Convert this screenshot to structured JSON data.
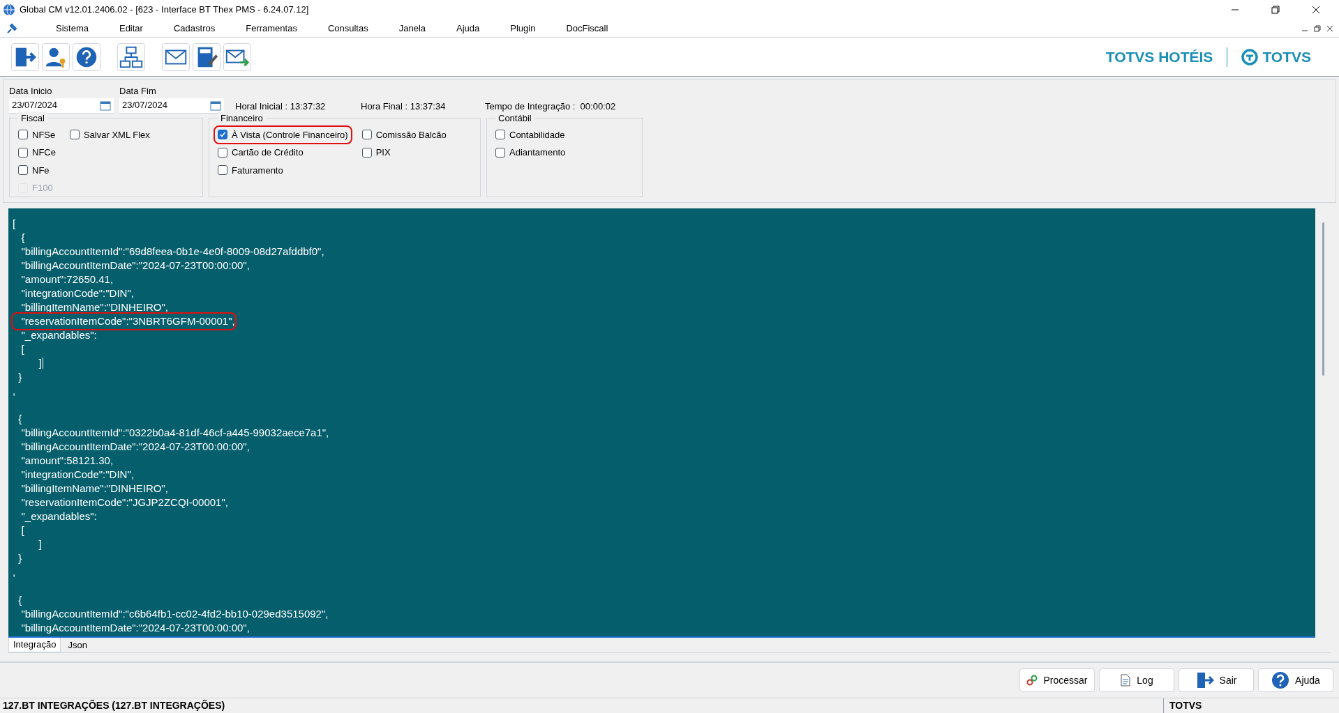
{
  "window": {
    "title": "Global CM v12.01.2406.02 - [623 - Interface BT Thex PMS - 6.24.07.12]"
  },
  "menu": [
    "Sistema",
    "Editar",
    "Cadastros",
    "Ferramentas",
    "Consultas",
    "Janela",
    "Ajuda",
    "Plugin",
    "DocFiscall"
  ],
  "brand": {
    "hotels": "TOTVS HOTÉIS",
    "logo": "TOTVS"
  },
  "dates": [
    {
      "label": "Data Inicio",
      "value": "23/07/2024"
    },
    {
      "label": "Data Fim",
      "value": "23/07/2024"
    }
  ],
  "times": [
    "Horal Inicial : 13:37:32",
    "Hora Final : 13:37:34",
    "Tempo de Integração :  00:00:02"
  ],
  "groups": [
    {
      "title": "Fiscal",
      "columns": [
        [
          {
            "label": "NFSe",
            "checked": false,
            "disabled": false,
            "highlighted": false
          },
          {
            "label": "NFCe",
            "checked": false,
            "disabled": false,
            "highlighted": false
          },
          {
            "label": "NFe",
            "checked": false,
            "disabled": false,
            "highlighted": false
          },
          {
            "label": "F100",
            "checked": false,
            "disabled": true,
            "highlighted": false
          }
        ],
        [
          {
            "label": "Salvar XML Flex",
            "checked": false,
            "disabled": false,
            "highlighted": false
          }
        ]
      ]
    },
    {
      "title": "Financeiro",
      "columns": [
        [
          {
            "label": "À Vista (Controle Financeiro)",
            "checked": true,
            "disabled": false,
            "highlighted": true
          },
          {
            "label": "Cartão de Crédito",
            "checked": false,
            "disabled": false,
            "highlighted": false
          },
          {
            "label": "Faturamento",
            "checked": false,
            "disabled": false,
            "highlighted": false
          }
        ],
        [
          {
            "label": "Comissão Balcão",
            "checked": false,
            "disabled": false,
            "highlighted": false
          },
          {
            "label": "PIX",
            "checked": false,
            "disabled": false,
            "highlighted": false
          }
        ]
      ]
    },
    {
      "title": "Contábil",
      "columns": [
        [
          {
            "label": "Contabilidade",
            "checked": false,
            "disabled": false,
            "highlighted": false
          },
          {
            "label": "Adiantamento",
            "checked": false,
            "disabled": false,
            "highlighted": false
          }
        ]
      ]
    }
  ],
  "json_lines": [
    {
      "kind": "line",
      "text": "[",
      "highlighted": false,
      "cursor": false
    },
    {
      "kind": "line",
      "text": "   {",
      "highlighted": false,
      "cursor": false
    },
    {
      "kind": "line",
      "text": "   \"billingAccountItemId\":\"69d8feea-0b1e-4e0f-8009-08d27afddbf0\",",
      "highlighted": false,
      "cursor": false
    },
    {
      "kind": "line",
      "text": "   \"billingAccountItemDate\":\"2024-07-23T00:00:00\",",
      "highlighted": false,
      "cursor": false
    },
    {
      "kind": "line",
      "text": "   \"amount\":72650.41,",
      "highlighted": false,
      "cursor": false
    },
    {
      "kind": "line",
      "text": "   \"integrationCode\":\"DIN\",",
      "highlighted": false,
      "cursor": false
    },
    {
      "kind": "line",
      "text": "   \"billingItemName\":\"DINHEIRO\",",
      "highlighted": false,
      "cursor": false
    },
    {
      "kind": "line",
      "text": "   \"reservationItemCode\":\"3NBRT6GFM-00001\",",
      "highlighted": true,
      "cursor": false
    },
    {
      "kind": "line",
      "text": "   \"_expandables\":",
      "highlighted": false,
      "cursor": false
    },
    {
      "kind": "line",
      "text": "   [",
      "highlighted": false,
      "cursor": false
    },
    {
      "kind": "line",
      "text": "         ]",
      "highlighted": false,
      "cursor": true
    },
    {
      "kind": "line",
      "text": "  }",
      "highlighted": false,
      "cursor": false
    },
    {
      "kind": "line",
      "text": ",",
      "highlighted": false,
      "cursor": false
    },
    {
      "kind": "blank"
    },
    {
      "kind": "line",
      "text": "  {",
      "highlighted": false,
      "cursor": false
    },
    {
      "kind": "line",
      "text": "   \"billingAccountItemId\":\"0322b0a4-81df-46cf-a445-99032aece7a1\",",
      "highlighted": false,
      "cursor": false
    },
    {
      "kind": "line",
      "text": "   \"billingAccountItemDate\":\"2024-07-23T00:00:00\",",
      "highlighted": false,
      "cursor": false
    },
    {
      "kind": "line",
      "text": "   \"amount\":58121.30,",
      "highlighted": false,
      "cursor": false
    },
    {
      "kind": "line",
      "text": "   \"integrationCode\":\"DIN\",",
      "highlighted": false,
      "cursor": false
    },
    {
      "kind": "line",
      "text": "   \"billingItemName\":\"DINHEIRO\",",
      "highlighted": false,
      "cursor": false
    },
    {
      "kind": "line",
      "text": "   \"reservationItemCode\":\"JGJP2ZCQI-00001\",",
      "highlighted": false,
      "cursor": false
    },
    {
      "kind": "line",
      "text": "   \"_expandables\":",
      "highlighted": false,
      "cursor": false
    },
    {
      "kind": "line",
      "text": "   [",
      "highlighted": false,
      "cursor": false
    },
    {
      "kind": "line",
      "text": "         ]",
      "highlighted": false,
      "cursor": false
    },
    {
      "kind": "line",
      "text": "  }",
      "highlighted": false,
      "cursor": false
    },
    {
      "kind": "line",
      "text": ",",
      "highlighted": false,
      "cursor": false
    },
    {
      "kind": "blank"
    },
    {
      "kind": "line",
      "text": "  {",
      "highlighted": false,
      "cursor": false
    },
    {
      "kind": "line",
      "text": "   \"billingAccountItemId\":\"c6b64fb1-cc02-4fd2-bb10-029ed3515092\",",
      "highlighted": false,
      "cursor": false
    },
    {
      "kind": "line",
      "text": "   \"billingAccountItemDate\":\"2024-07-23T00:00:00\",",
      "highlighted": false,
      "cursor": false
    }
  ],
  "tabs": [
    {
      "label": "Integração",
      "selected": true
    },
    {
      "label": "Json",
      "selected": false
    }
  ],
  "buttons": [
    "Processar",
    "Log",
    "Sair",
    "Ajuda"
  ],
  "status_bar": [
    "127.BT INTEGRAÇÕES (127.BT INTEGRAÇÕES)",
    "TOTVS"
  ]
}
